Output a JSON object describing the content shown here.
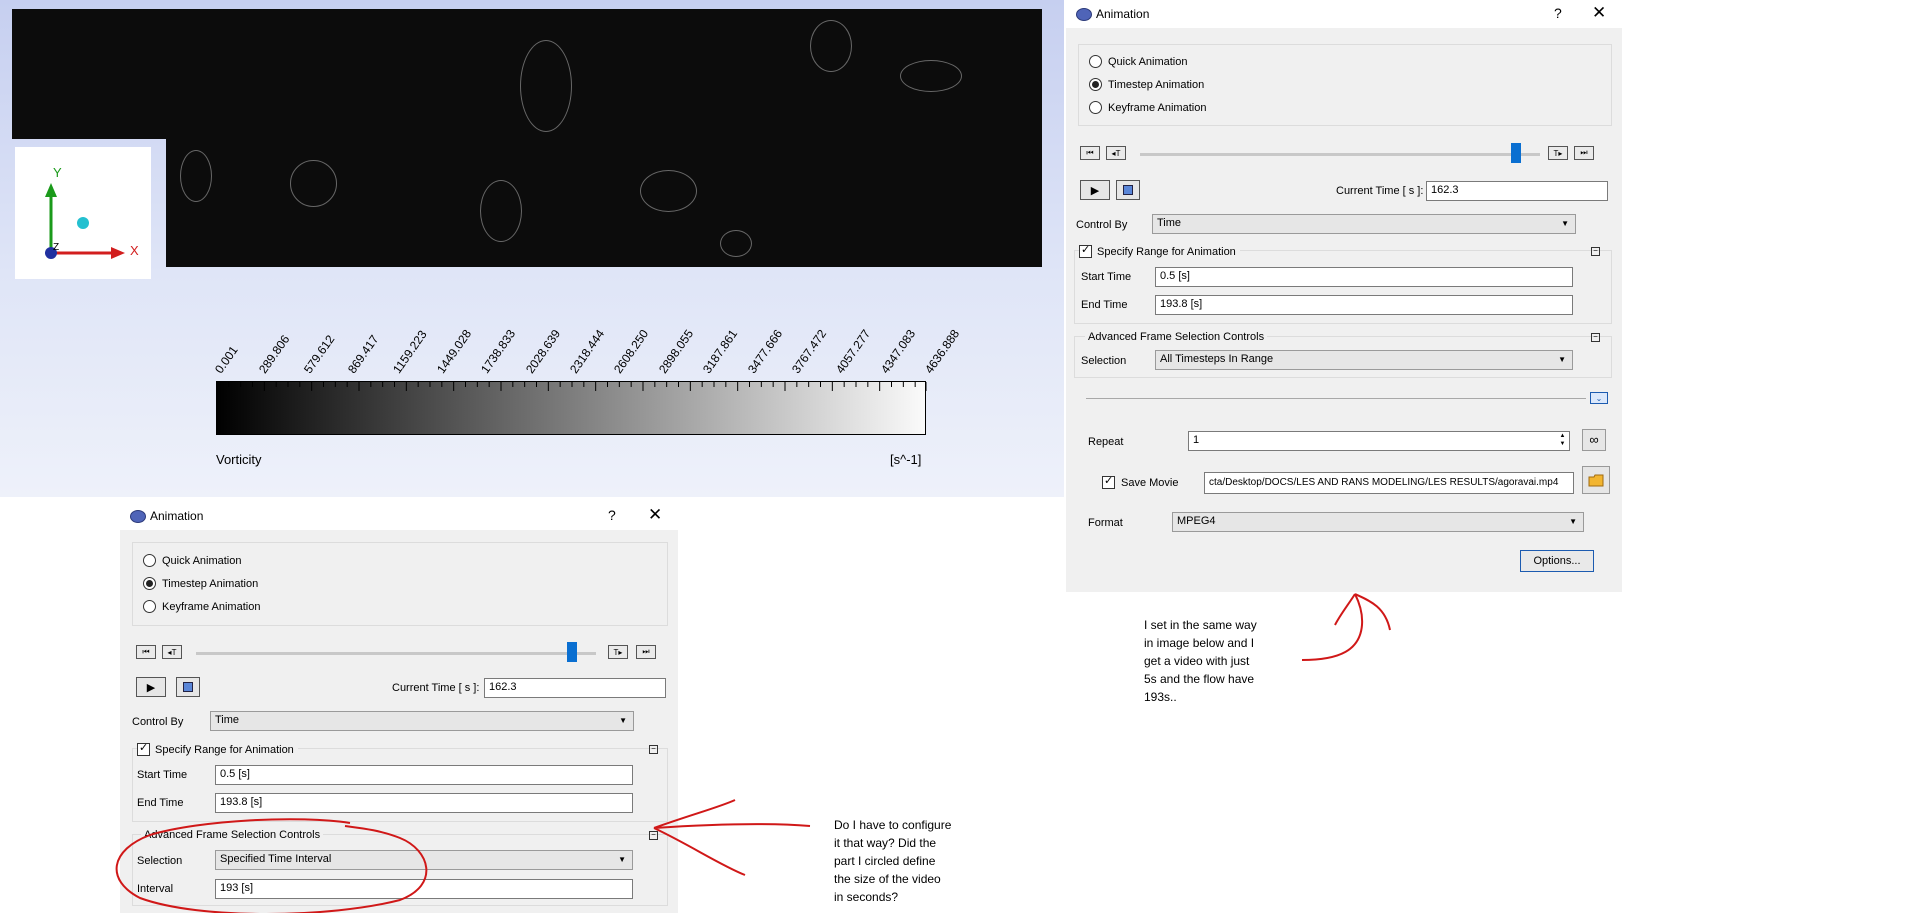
{
  "legend": {
    "ticks": [
      "0.001",
      "289.806",
      "579.612",
      "869.417",
      "1159.223",
      "1449.028",
      "1738.833",
      "2028.639",
      "2318.444",
      "2608.250",
      "2898.055",
      "3187.861",
      "3477.666",
      "3767.472",
      "4057.277",
      "4347.083",
      "4636.888"
    ],
    "title": "Vorticity",
    "unit": "[s^-1]"
  },
  "axes": {
    "y_label": "Y",
    "x_label": "X",
    "z_label": "Z",
    "y_color": "#1a9a1a",
    "x_color": "#d21e1e",
    "z_color": "#2030a0",
    "sphere_color": "#24c0d0"
  },
  "dialog_right": {
    "title": "Animation",
    "help": "?",
    "close": "✕",
    "modes": [
      "Quick Animation",
      "Timestep Animation",
      "Keyframe Animation"
    ],
    "selected_mode": "Timestep Animation",
    "current_time_label": "Current Time [ s ]:",
    "current_time": "162.3",
    "control_by_label": "Control By",
    "control_by": "Time",
    "specify_range_label": "Specify Range for Animation",
    "start_time_label": "Start Time",
    "start_time": "0.5 [s]",
    "end_time_label": "End Time",
    "end_time": "193.8 [s]",
    "advanced_label": "Advanced Frame Selection Controls",
    "selection_label": "Selection",
    "selection": "All Timesteps In Range",
    "repeat_label": "Repeat",
    "repeat": "1",
    "save_movie_label": "Save Movie",
    "movie_path": "cta/Desktop/DOCS/LES AND RANS MODELING/LES RESULTS/agoravai.mp4",
    "format_label": "Format",
    "format": "MPEG4",
    "options_button": "Options...",
    "slider_value": 0.94
  },
  "dialog_left": {
    "title": "Animation",
    "help": "?",
    "close": "✕",
    "modes": [
      "Quick Animation",
      "Timestep Animation",
      "Keyframe Animation"
    ],
    "selected_mode": "Timestep Animation",
    "current_time_label": "Current Time [ s ]:",
    "current_time": "162.3",
    "control_by_label": "Control By",
    "control_by": "Time",
    "specify_range_label": "Specify Range for Animation",
    "start_time_label": "Start Time",
    "start_time": "0.5 [s]",
    "end_time_label": "End Time",
    "end_time": "193.8 [s]",
    "advanced_label": "Advanced Frame Selection Controls",
    "selection_label": "Selection",
    "selection": "Specified Time Interval",
    "interval_label": "Interval",
    "interval": "193 [s]",
    "slider_value": 0.94
  },
  "annotations": {
    "note_right": "I set in the same way\nin image below and I\nget a video with just\n5s and the flow have\n193s..",
    "note_left": "Do I have to configure\nit that way? Did the\npart I circled define\nthe size of the video\nin seconds?",
    "ink_color": "#d01818"
  }
}
